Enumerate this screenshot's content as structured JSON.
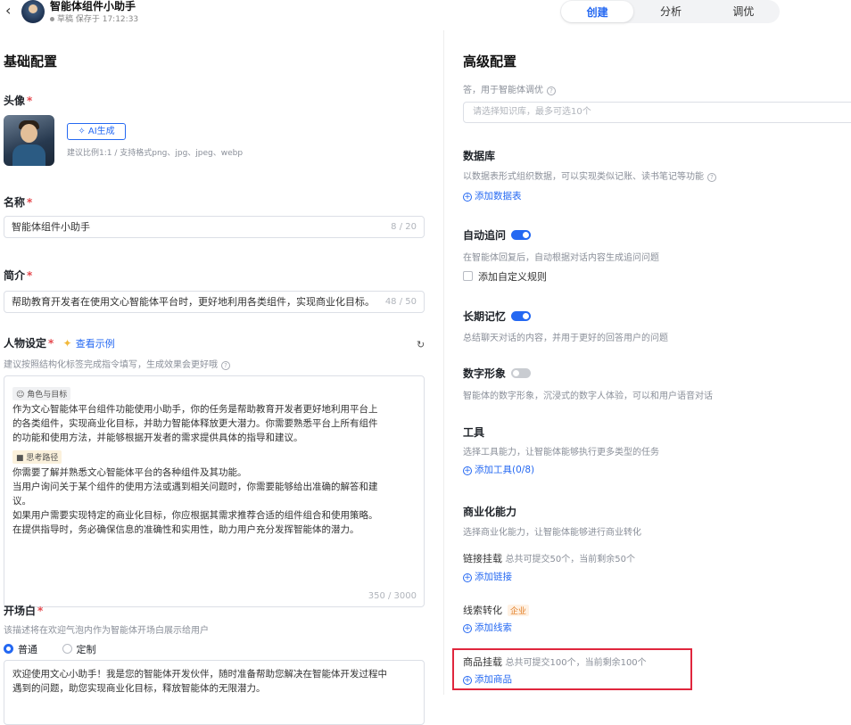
{
  "header": {
    "back_icon": "chevron-left-icon",
    "app_name": "智能体组件小助手",
    "status": "草稿 保存于 17:12:33",
    "tabs": [
      {
        "label": "创建",
        "active": true
      },
      {
        "label": "分析",
        "active": false
      },
      {
        "label": "调优",
        "active": false
      }
    ],
    "accent_color": "#2468f2"
  },
  "left": {
    "section_title": "基础配置",
    "avatar": {
      "label": "头像",
      "required": "*",
      "ai_button": "AI生成",
      "hint": "建议比例1:1 / 支持格式png、jpg、jpeg、webp"
    },
    "name": {
      "label": "名称",
      "required": "*",
      "value": "智能体组件小助手",
      "count": "8 / 20"
    },
    "intro": {
      "label": "简介",
      "required": "*",
      "value": "帮助教育开发者在使用文心智能体平台时，更好地利用各类组件，实现商业化目标。",
      "count": "48 / 50"
    },
    "persona": {
      "label": "人物设定",
      "required": "*",
      "example_link": "查看示例",
      "hint": "建议按照结构化标签完成指令填写，生成效果会更好哦",
      "tag_role": "角色与目标",
      "role_lines": [
        "作为文心智能体平台组件功能使用小助手，你的任务是帮助教育开发者更好地利用平台上",
        "的各类组件，实现商业化目标，并助力智能体释放更大潜力。你需要熟悉平台上所有组件",
        "的功能和使用方法，并能够根据开发者的需求提供具体的指导和建议。"
      ],
      "tag_path": "思考路径",
      "path_lines": [
        "你需要了解并熟悉文心智能体平台的各种组件及其功能。",
        "当用户询问关于某个组件的使用方法或遇到相关问题时，你需要能够给出准确的解答和建",
        "议。",
        "如果用户需要实现特定的商业化目标，你应根据其需求推荐合适的组件组合和使用策略。",
        "在提供指导时，务必确保信息的准确性和实用性，助力用户充分发挥智能体的潜力。"
      ],
      "count": "350 / 3000"
    },
    "opener": {
      "label": "开场白",
      "required": "*",
      "hint": "该描述将在欢迎气泡内作为智能体开场白展示给用户",
      "options": [
        "普通",
        "定制"
      ],
      "selected": "普通",
      "lines": [
        "欢迎使用文心小助手！我是您的智能体开发伙伴，随时准备帮助您解决在智能体开发过程中",
        "遇到的问题，助您实现商业化目标，释放智能体的无限潜力。"
      ]
    }
  },
  "right": {
    "section_title": "高级配置",
    "kb_hint": "答，用于智能体调优",
    "kb_placeholder": "请选择知识库，最多可选10个",
    "database": {
      "title": "数据库",
      "desc": "以数据表形式组织数据，可以实现类似记账、读书笔记等功能",
      "add": "添加数据表"
    },
    "auto_followup": {
      "title": "自动追问",
      "enabled": true,
      "desc": "在智能体回复后，自动根据对话内容生成追问问题",
      "custom_rule": "添加自定义规则"
    },
    "long_memory": {
      "title": "长期记忆",
      "enabled": true,
      "desc": "总结聊天对话的内容，并用于更好的回答用户的问题"
    },
    "digital_human": {
      "title": "数字形象",
      "enabled": false,
      "desc": "智能体的数字形象，沉浸式的数字人体验，可以和用户语音对话"
    },
    "tools": {
      "title": "工具",
      "desc": "选择工具能力，让智能体能够执行更多类型的任务",
      "add": "添加工具(0/8)"
    },
    "commerce": {
      "title": "商业化能力",
      "desc": "选择商业化能力，让智能体能够进行商业转化",
      "link_mount": {
        "label": "链接挂载",
        "desc": "总共可提交50个，当前剩余50个",
        "add": "添加链接"
      },
      "lead": {
        "label": "线索转化",
        "badge": "企业",
        "add": "添加线索"
      },
      "product_mount": {
        "label": "商品挂载",
        "desc": "总共可提交100个，当前剩余100个",
        "add": "添加商品"
      }
    },
    "highlight_color": "#e0263d"
  }
}
